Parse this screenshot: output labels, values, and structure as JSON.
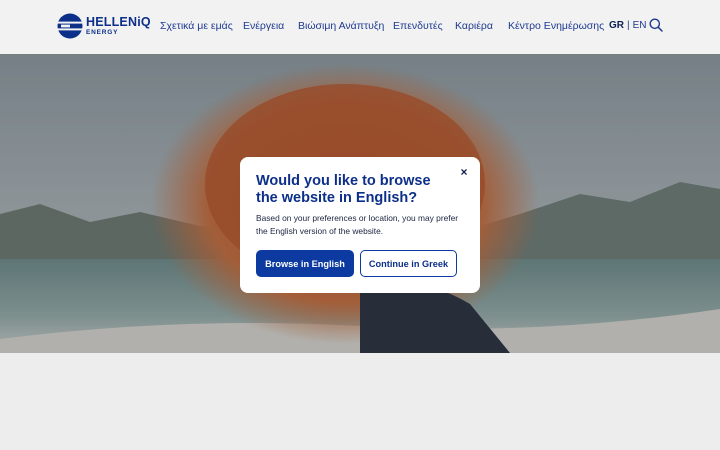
{
  "header": {
    "logo": {
      "word": "HELLENiQ",
      "sub": "ENERGY"
    },
    "nav": [
      {
        "label": "Σχετικά με εμάς"
      },
      {
        "label": "Ενέργεια"
      },
      {
        "label": "Βιώσιμη Ανάπτυξη"
      },
      {
        "label": "Επενδυτές"
      },
      {
        "label": "Καριέρα"
      },
      {
        "label": "Κέντρο Ενημέρωσης"
      }
    ],
    "lang": {
      "active": "GR",
      "separator": "|",
      "other": "EN"
    },
    "search_icon": "search-icon"
  },
  "hero": {
    "image": "woman with windblown red hair on a beach"
  },
  "modal": {
    "title": "Would you like to browse the website in English?",
    "body": "Based on your preferences or location, you may prefer the English version of the website.",
    "close_label": "×",
    "primary_label": "Browse in English",
    "secondary_label": "Continue in Greek"
  },
  "colors": {
    "brand": "#0c2f8a",
    "primary_button": "#0c3aa0",
    "header_bg": "#f2f2f3",
    "page_bg": "#ededee"
  }
}
